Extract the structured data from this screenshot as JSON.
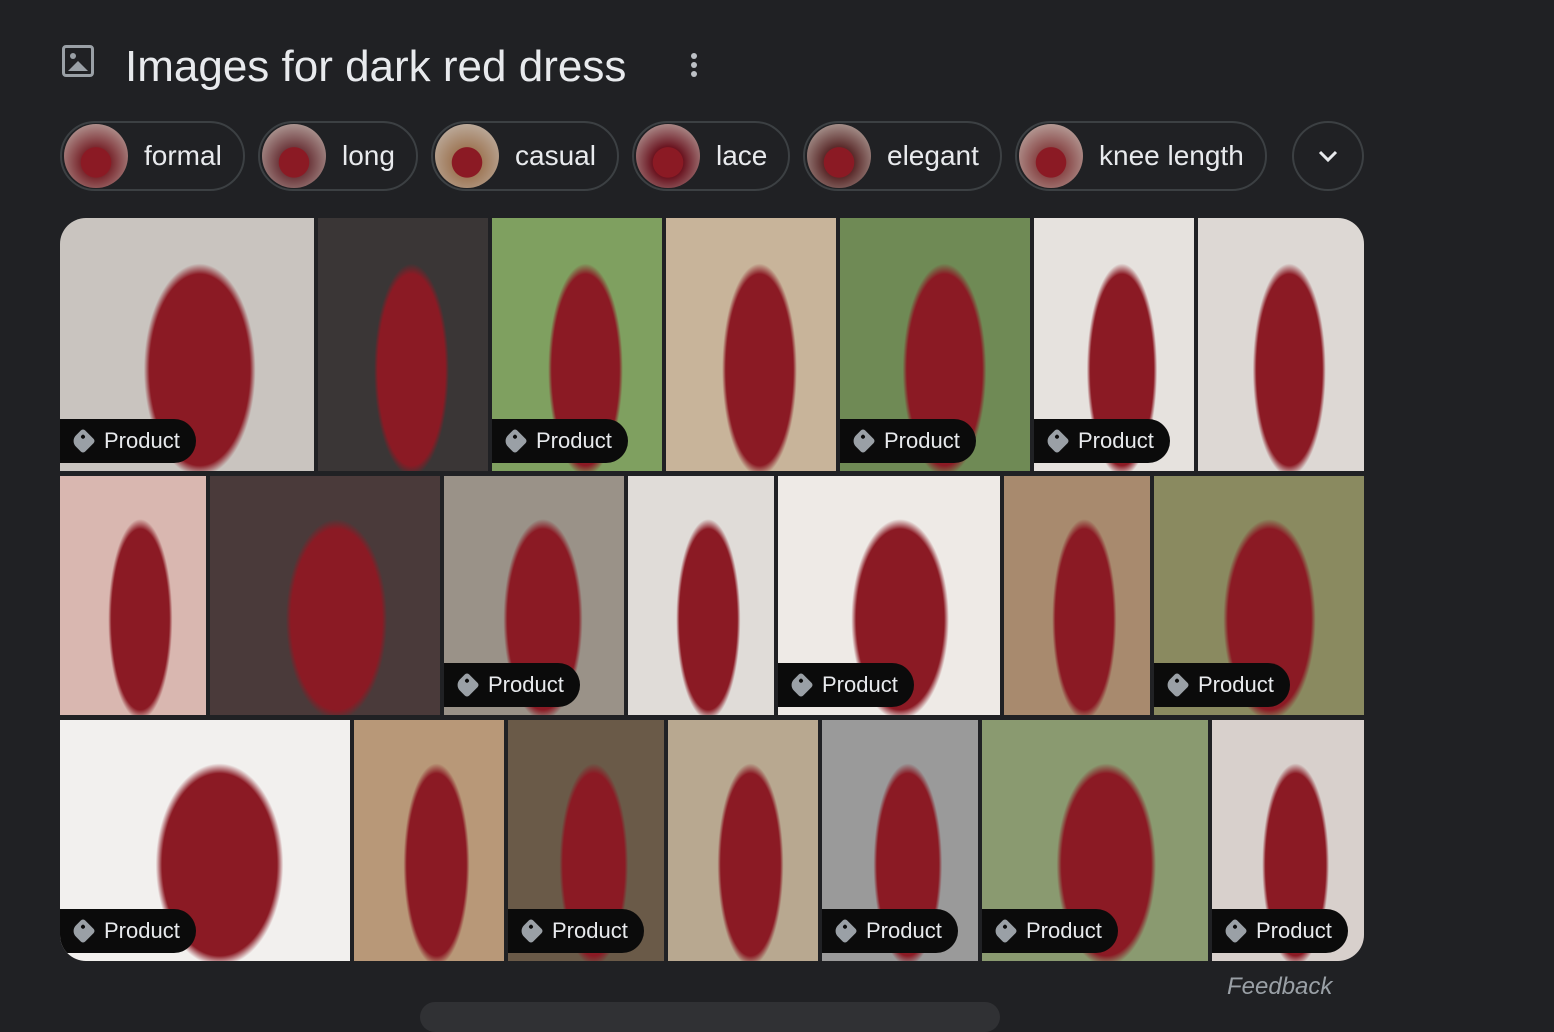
{
  "header": {
    "title": "Images for dark red dress",
    "icon": "image-icon",
    "menu_icon": "more-vert-icon"
  },
  "chips": [
    {
      "label": "formal"
    },
    {
      "label": "long"
    },
    {
      "label": "casual"
    },
    {
      "label": "lace"
    },
    {
      "label": "elegant"
    },
    {
      "label": "knee length"
    }
  ],
  "expand_icon": "chevron-down-icon",
  "badge_label": "Product",
  "tiles": [
    [
      {
        "product": true
      },
      {
        "product": false
      },
      {
        "product": true
      },
      {
        "product": false
      },
      {
        "product": true
      },
      {
        "product": true
      },
      {
        "product": false
      }
    ],
    [
      {
        "product": false
      },
      {
        "product": false
      },
      {
        "product": true
      },
      {
        "product": false
      },
      {
        "product": true
      },
      {
        "product": false
      },
      {
        "product": true
      }
    ],
    [
      {
        "product": true
      },
      {
        "product": false
      },
      {
        "product": true
      },
      {
        "product": false
      },
      {
        "product": true
      },
      {
        "product": true
      },
      {
        "product": true
      }
    ]
  ],
  "feedback": "Feedback",
  "colors": {
    "background": "#202124",
    "dress": "#8b1a24",
    "badge": "#0b0b0b"
  }
}
